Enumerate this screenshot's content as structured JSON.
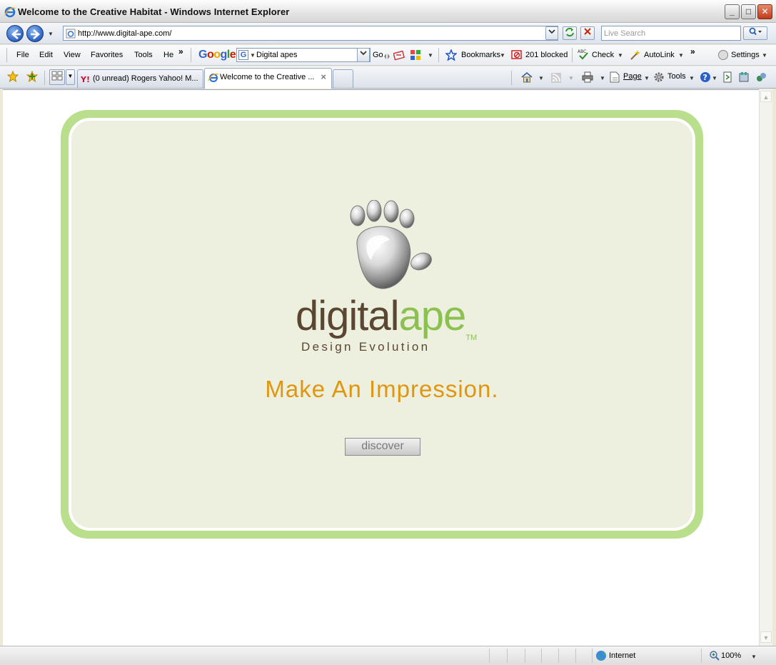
{
  "window": {
    "title": "Welcome to the Creative Habitat - Windows Internet Explorer",
    "minimize": "_",
    "maximize": "□",
    "close": "✕"
  },
  "navbar": {
    "address": "http://www.digital-ape.com/",
    "search_placeholder": "Live Search"
  },
  "menu": {
    "items": [
      "File",
      "Edit",
      "View",
      "Favorites",
      "Tools",
      "He"
    ],
    "overflow": "»"
  },
  "google_toolbar": {
    "logo": [
      "G",
      "o",
      "o",
      "g",
      "l",
      "e"
    ],
    "search_value": "Digital apes",
    "go_label": "Go",
    "bookmarks_label": "Bookmarks",
    "blocked_label": "201 blocked",
    "check_label": "Check",
    "autolink_label": "AutoLink",
    "overflow": "»",
    "settings_label": "Settings"
  },
  "tabs": [
    {
      "label": "(0 unread) Rogers Yahoo! M...",
      "active": false
    },
    {
      "label": "Welcome to the Creative ...",
      "active": true
    }
  ],
  "command_bar": {
    "page_label": "Page",
    "tools_label": "Tools"
  },
  "page": {
    "brand_dark": "digital",
    "brand_light": "ape",
    "trademark": "TM",
    "tagline": "Design Evolution",
    "headline": "Make An Impression.",
    "discover_label": "discover"
  },
  "statusbar": {
    "zone": "Internet",
    "zoom": "100%"
  },
  "colors": {
    "border_green": "#b9df8c",
    "card_fill": "#edf0df",
    "brand_brown": "#5b4632",
    "brand_green": "#8cc152",
    "headline_orange": "#e0960e"
  }
}
